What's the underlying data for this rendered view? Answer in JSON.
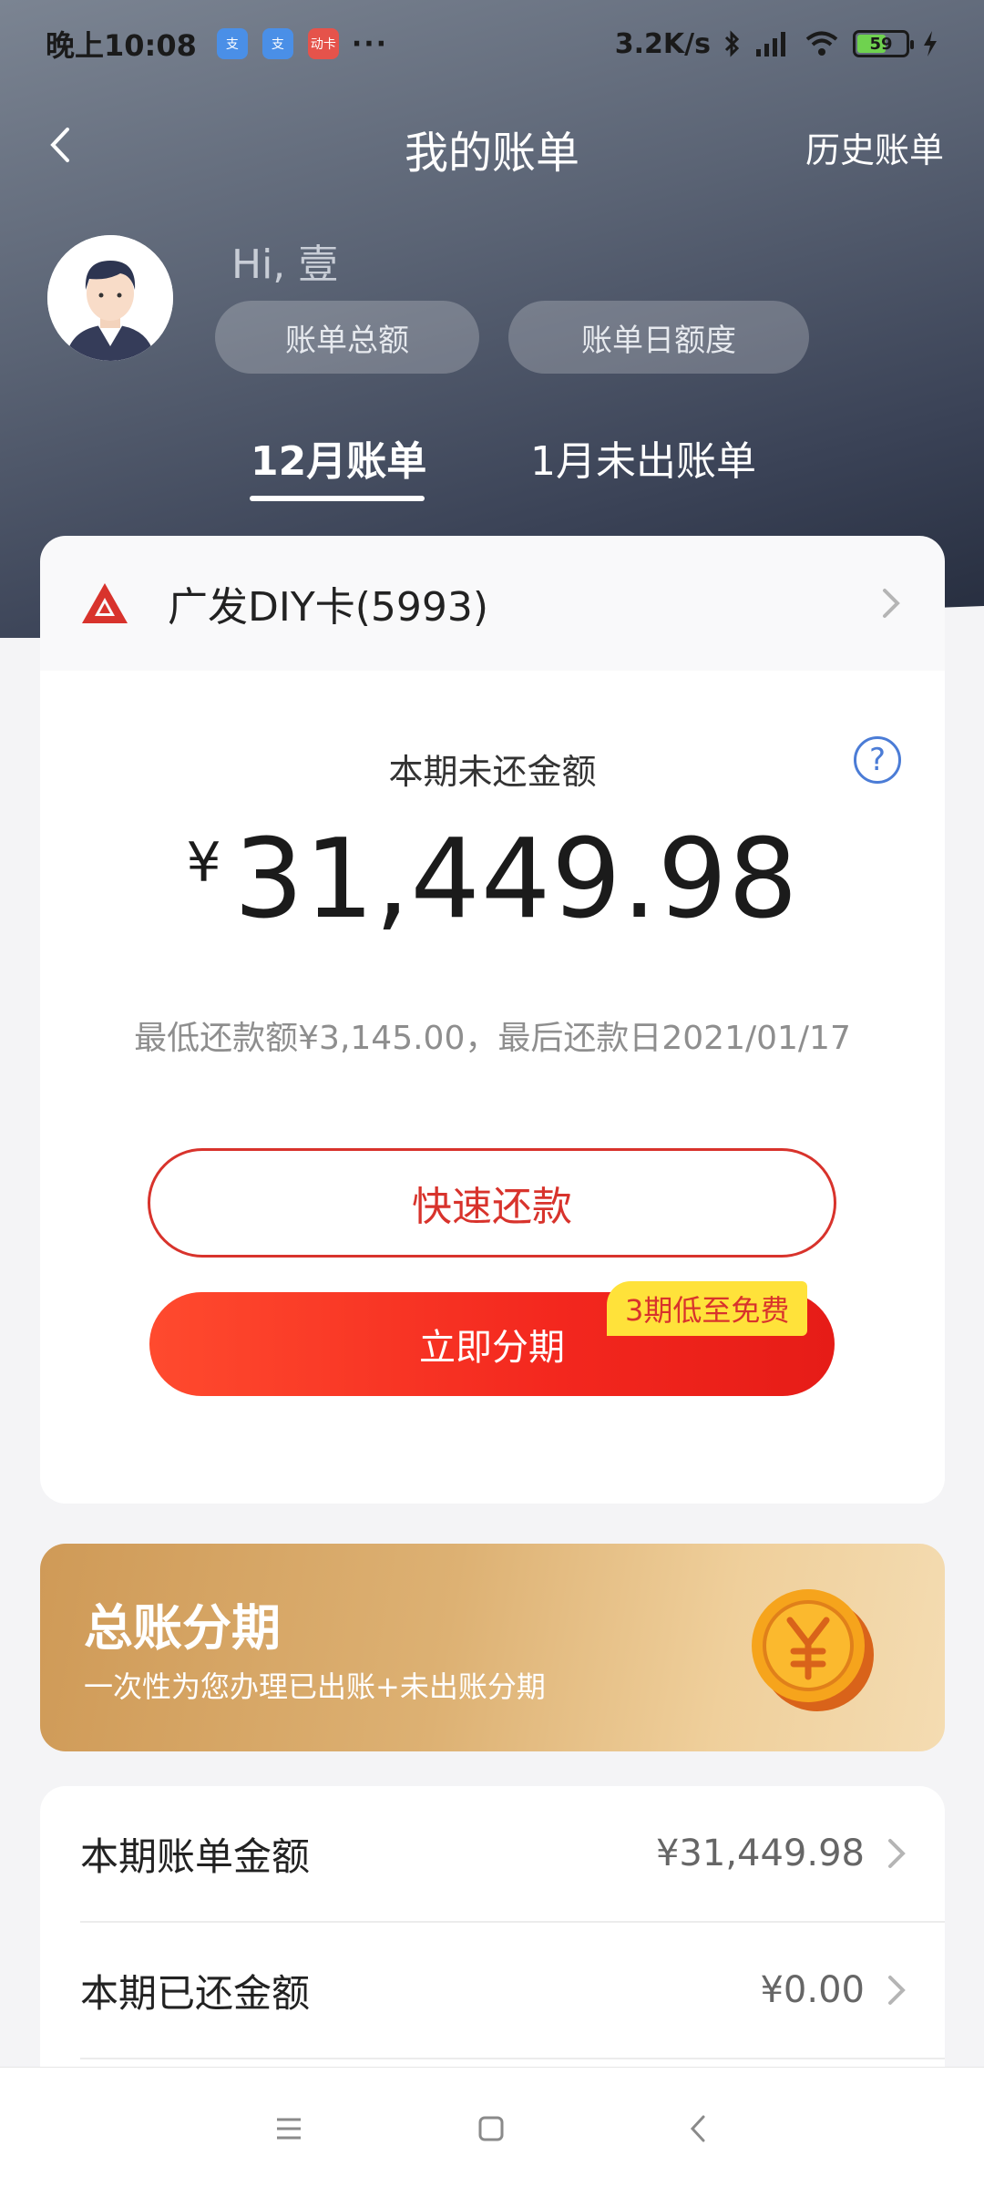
{
  "status_bar": {
    "time": "晚上10:08",
    "apps": [
      "支",
      "支",
      "动卡"
    ],
    "more": "···",
    "network_speed": "3.2K/s",
    "battery": "59"
  },
  "nav": {
    "title": "我的账单",
    "history": "历史账单"
  },
  "user": {
    "greeting": "Hi, 壹",
    "pill_total": "账单总额",
    "pill_daily": "账单日额度"
  },
  "tabs": [
    {
      "label": "12月账单",
      "active": true
    },
    {
      "label": "1月未出账单",
      "active": false
    }
  ],
  "card": {
    "name": "广发DIY卡(5993)"
  },
  "bill": {
    "due_label": "本期未还金额",
    "currency": "¥",
    "amount": "31,449.98",
    "min_payment_text": "最低还款额¥3,145.00，最后还款日2021/01/17",
    "help": "?"
  },
  "actions": {
    "repay": "快速还款",
    "installment": "立即分期",
    "installment_badge": "3期低至免费"
  },
  "promo": {
    "title": "总账分期",
    "subtitle": "一次性为您办理已出账+未出账分期"
  },
  "list": [
    {
      "label": "本期账单金额",
      "value": "¥31,449.98"
    },
    {
      "label": "本期已还金额",
      "value": "¥0.00"
    }
  ],
  "colors": {
    "accent_red": "#d8332c",
    "badge_yellow": "#ffe23a",
    "promo_gold": "#cf9a57"
  }
}
